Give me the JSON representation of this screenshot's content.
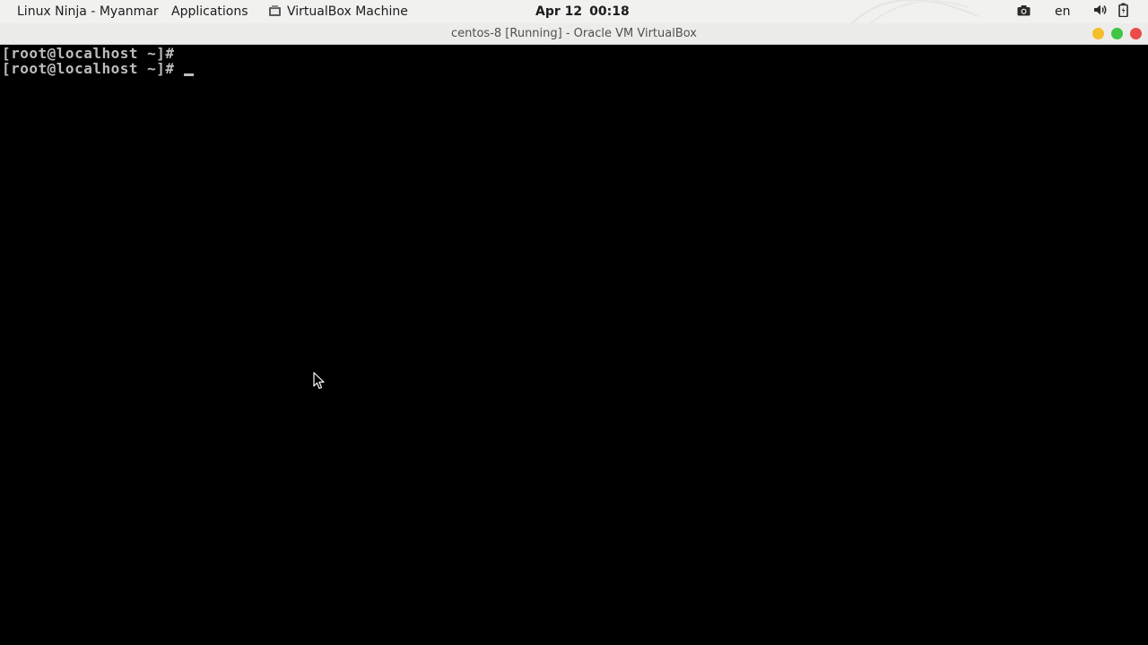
{
  "topbar": {
    "workspace_label": "Linux Ninja - Myanmar",
    "applications_label": "Applications",
    "active_app_label": "VirtualBox Machine",
    "clock_date": "Apr 12",
    "clock_time": "00:18",
    "language": "en",
    "icons": [
      "virtualbox-icon",
      "camera-icon",
      "volume-icon",
      "battery-icon"
    ]
  },
  "window": {
    "title": "centos-8 [Running] - Oracle VM VirtualBox",
    "controls": {
      "minimize_color": "#f4bf2d",
      "maximize_color": "#3fc644",
      "close_color": "#ea4c47"
    }
  },
  "console": {
    "lines": [
      "[root@localhost ~]#",
      "[root@localhost ~]#"
    ],
    "background": "#000000",
    "text_color": "#bdbdbd"
  }
}
